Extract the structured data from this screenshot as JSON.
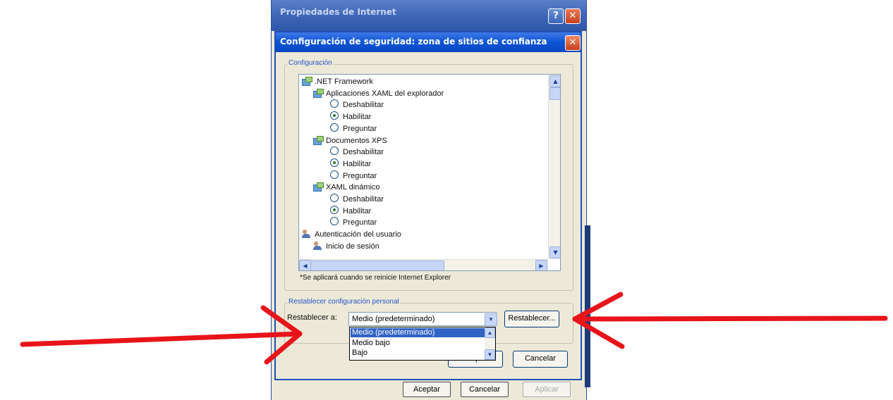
{
  "background_window": {
    "title": "Propiedades de Internet",
    "help_glyph": "?",
    "close_glyph": "✕",
    "buttons": {
      "aceptar": "Aceptar",
      "cancelar": "Cancelar",
      "aplicar": "Aplicar"
    }
  },
  "dialog": {
    "title": "Configuración de seguridad: zona de sitios de confianza",
    "close_glyph": "✕",
    "settings_group": {
      "title": "Configuración",
      "items": [
        {
          "type": "category",
          "icon": "settings-icon",
          "label": ".NET Framework"
        },
        {
          "type": "category",
          "icon": "settings-icon",
          "label": "Aplicaciones XAML del explorador"
        },
        {
          "type": "radio",
          "label": "Deshabilitar",
          "selected": false
        },
        {
          "type": "radio",
          "label": "Habilitar",
          "selected": true
        },
        {
          "type": "radio",
          "label": "Preguntar",
          "selected": false
        },
        {
          "type": "category",
          "icon": "settings-icon",
          "label": "Documentos XPS"
        },
        {
          "type": "radio",
          "label": "Deshabilitar",
          "selected": false
        },
        {
          "type": "radio",
          "label": "Habilitar",
          "selected": true
        },
        {
          "type": "radio",
          "label": "Preguntar",
          "selected": false
        },
        {
          "type": "category",
          "icon": "settings-icon",
          "label": "XAML dinámico"
        },
        {
          "type": "radio",
          "label": "Deshabilitar",
          "selected": false
        },
        {
          "type": "radio",
          "label": "Habilitar",
          "selected": true
        },
        {
          "type": "radio",
          "label": "Preguntar",
          "selected": false
        },
        {
          "type": "category",
          "icon": "user-icon",
          "label": "Autenticación del usuario"
        },
        {
          "type": "category",
          "icon": "user-icon",
          "label": "Inicio de sesión"
        }
      ],
      "scroll_up_glyph": "▲",
      "scroll_down_glyph": "▼",
      "scroll_left_glyph": "◀",
      "scroll_right_glyph": "▶",
      "restart_note": "*Se aplicará cuando se reinicie Internet Explorer"
    },
    "reset_group": {
      "title": "Restablecer configuración personal",
      "label": "Restablecer a:",
      "selected_value": "Medio (predeterminado)",
      "combo_arrow_glyph": "▼",
      "reset_button": "Restablecer...",
      "dropdown_options": [
        "Medio (predeterminado)",
        "Medio bajo",
        "Bajo"
      ]
    },
    "buttons": {
      "accept": "Aceptar",
      "cancel": "Cancelar"
    }
  },
  "colors": {
    "annotation_arrow": "#e8141a",
    "title_bar": "#0d55d6",
    "selection": "#3163c5"
  }
}
